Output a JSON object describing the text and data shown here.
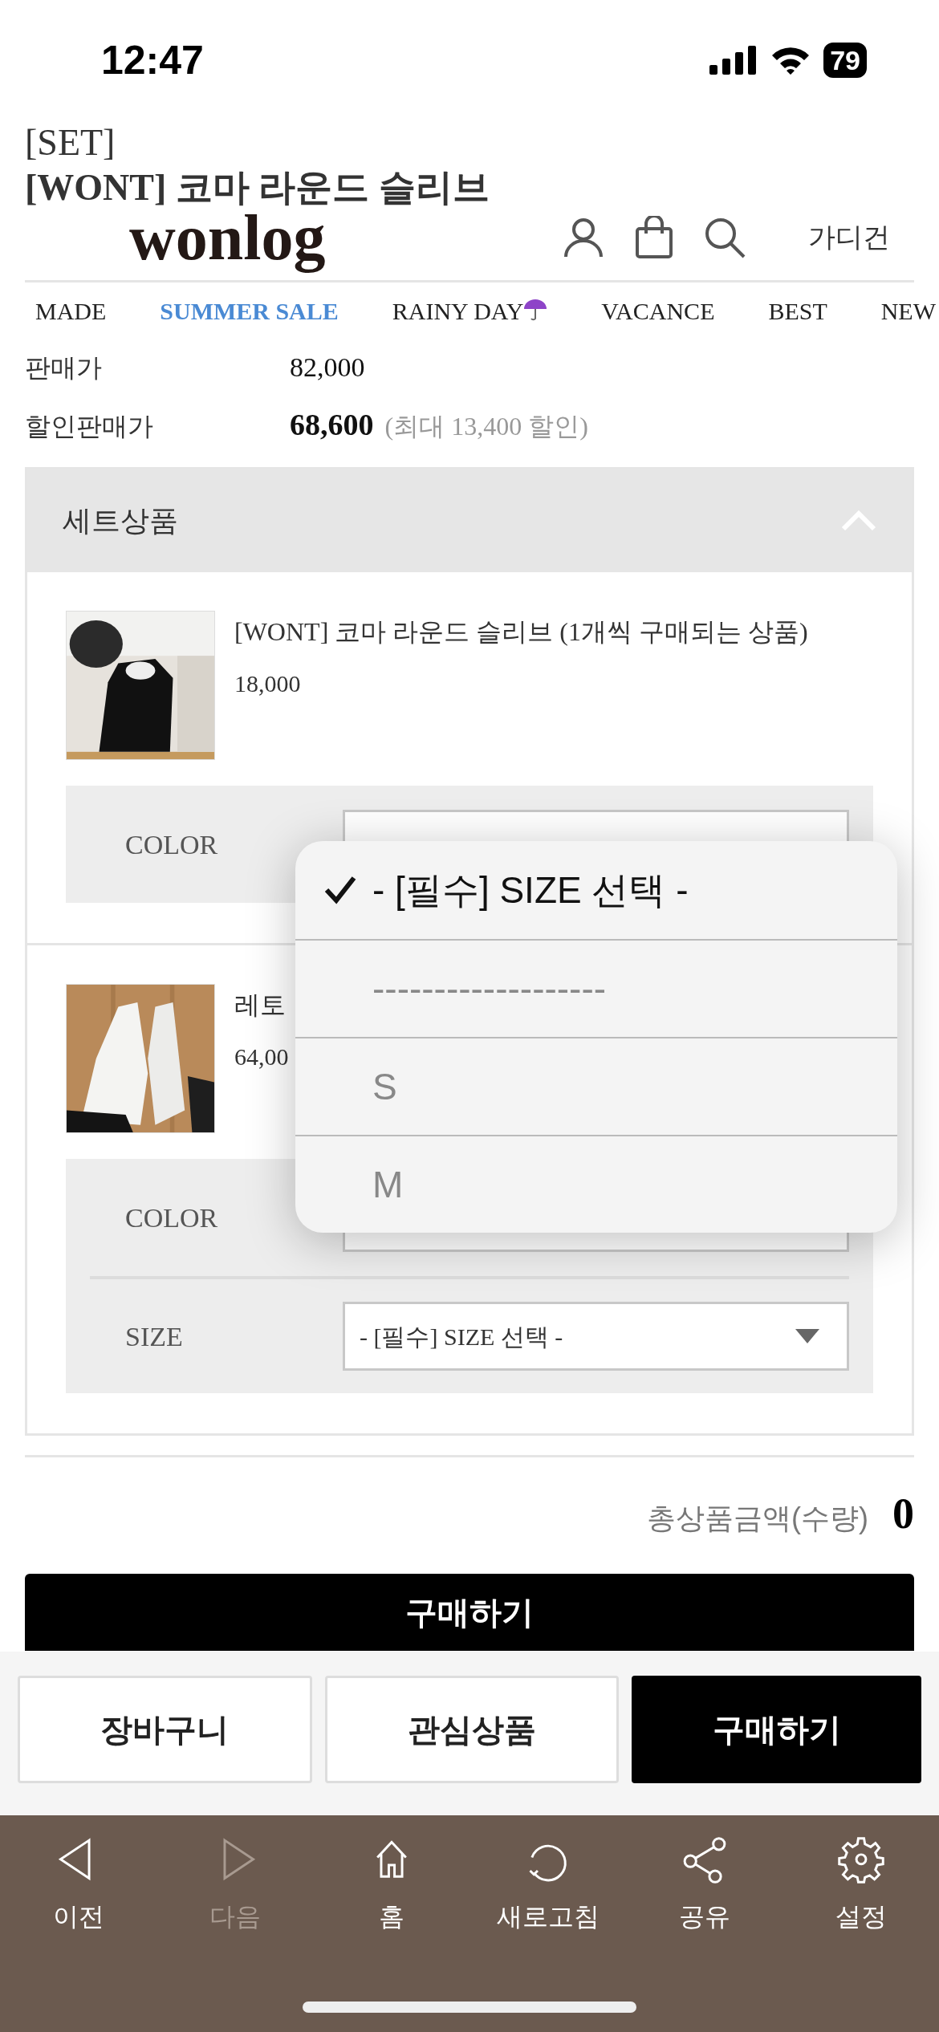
{
  "status_bar": {
    "time": "12:47",
    "battery": "79"
  },
  "header": {
    "title_lines": [
      "[SET]",
      "[WONT] 코마 라운드 슬리브"
    ],
    "logo": "wonlog",
    "search_term": "가디건"
  },
  "nav": [
    {
      "label": "MADE",
      "selected": false,
      "umbrella": false
    },
    {
      "label": "SUMMER SALE",
      "selected": true,
      "umbrella": false
    },
    {
      "label": "RAINY DAY",
      "selected": false,
      "umbrella": true
    },
    {
      "label": "VACANCE",
      "selected": false,
      "umbrella": false
    },
    {
      "label": "BEST",
      "selected": false,
      "umbrella": false
    },
    {
      "label": "NEW",
      "selected": false,
      "umbrella": false
    }
  ],
  "prices": [
    {
      "label": "판매가",
      "value": "82,000",
      "emphasis": false
    },
    {
      "label": "할인판매가",
      "value": "68,600",
      "note": "(최대 13,400 할인)",
      "emphasis": true
    }
  ],
  "set": {
    "title": "세트상품",
    "expanded": true,
    "products": [
      {
        "name": "[WONT] 코마 라운드 슬리브 (1개씩 구매되는 상품)",
        "price": "18,000",
        "options": [
          {
            "label": "COLOR"
          }
        ]
      },
      {
        "name": "레토",
        "price": "64,00",
        "options": [
          {
            "label": "COLOR"
          },
          {
            "label": "SIZE",
            "value": "- [필수] SIZE 선택 -"
          }
        ]
      }
    ]
  },
  "dropdown": [
    {
      "label": "- [필수] SIZE 선택 -",
      "selected": true
    },
    {
      "label": "-------------------",
      "selected": false
    },
    {
      "label": "S",
      "selected": false
    },
    {
      "label": "M",
      "selected": false
    }
  ],
  "total": {
    "label": "총상품금액(수량)",
    "value": "0"
  },
  "buy_bar": "구매하기",
  "actions": [
    {
      "label": "장바구니",
      "kind": "outline"
    },
    {
      "label": "관심상품",
      "kind": "outline"
    },
    {
      "label": "구매하기",
      "kind": "primary"
    }
  ],
  "toolbar": [
    {
      "label": "이전",
      "disabled": false
    },
    {
      "label": "다음",
      "disabled": true
    },
    {
      "label": "홈",
      "disabled": false
    },
    {
      "label": "새로고침",
      "disabled": false
    },
    {
      "label": "공유",
      "disabled": false
    },
    {
      "label": "설정",
      "disabled": false
    }
  ]
}
